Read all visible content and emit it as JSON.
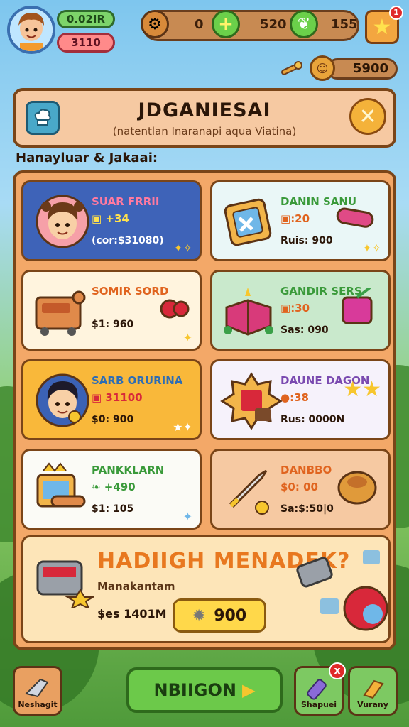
{
  "hud": {
    "level": "0.02IR",
    "hp": "3110",
    "resource_1_value": "0",
    "resource_2_value": "520",
    "resource_3_value": "155",
    "notification_count": "1",
    "gold": "5900"
  },
  "header": {
    "title": "JDGANIESAI",
    "subtitle": "(natentlan Inaranapi aqua Viatina)"
  },
  "section_label": "Hanayluar & Jakaai:",
  "cards": [
    {
      "title": "SUAR FRRII",
      "stat": "34",
      "price": "(cor:$31080)",
      "title_color": "#e8487a"
    },
    {
      "title": "DANIN SANU",
      "stat": ":20",
      "price": "Ruis: 900",
      "title_color": "#3a9a3a"
    },
    {
      "title": "SOMIR SORD",
      "stat": "",
      "price": "$1: 960",
      "title_color": "#e0641f"
    },
    {
      "title": "GANDIR SERS",
      "stat": ":30",
      "price": "Sas: 090",
      "title_color": "#3a9a3a"
    },
    {
      "title": "SARB ORURINA",
      "stat": "31100",
      "price": "$0: 900",
      "title_color": "#2d6db5"
    },
    {
      "title": "DAUNE DAGON",
      "stat": ":38",
      "price": "Rus: 0000N",
      "title_color": "#7a4ab0"
    },
    {
      "title": "PANKKLARN",
      "stat": "490",
      "price": "$1: 105",
      "title_color": "#3a9a3a"
    },
    {
      "title": "DANBBO",
      "stat": "$0: 00",
      "price": "Sa:$:50|0",
      "title_color": "#e0641f"
    }
  ],
  "featured": {
    "title": "HADIIGH MENADEK?",
    "subtitle": "Manakantam",
    "price": "$es 1401M",
    "buy_value": "900"
  },
  "nav": {
    "left_label": "Neshagit",
    "cta_label": "NBIIGON",
    "shop_label": "Shapuei",
    "shop_badge": "x",
    "last_label": "Vurany"
  },
  "colors": {
    "panel_border": "#7a4518",
    "panel_fill": "#f3a868",
    "cta_green": "#6cc94a"
  }
}
